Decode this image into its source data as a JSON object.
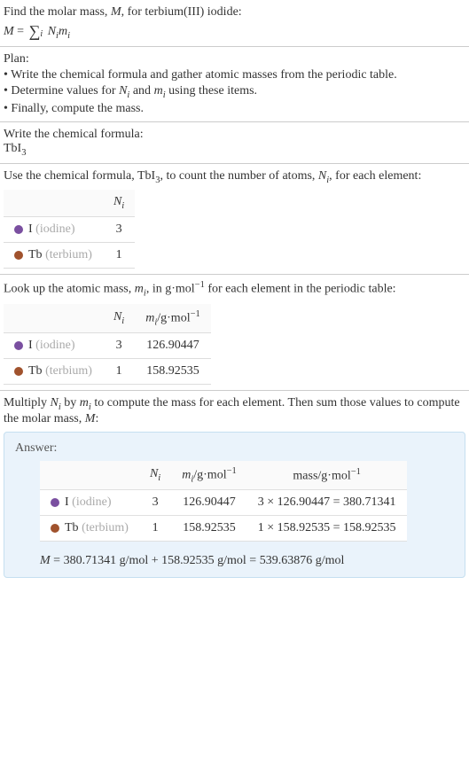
{
  "intro": {
    "line1_prefix": "Find the molar mass, ",
    "line1_var": "M",
    "line1_suffix": ", for terbium(III) iodide:",
    "formula_lhs": "M",
    "formula_eq": " = ",
    "formula_sum_index": "i",
    "formula_N": "N",
    "formula_N_sub": "i",
    "formula_m": "m",
    "formula_m_sub": "i"
  },
  "plan": {
    "title": "Plan:",
    "items": [
      "• Write the chemical formula and gather atomic masses from the periodic table.",
      "• Determine values for ",
      "• Finally, compute the mass."
    ],
    "item2_N": "N",
    "item2_N_sub": "i",
    "item2_mid": " and ",
    "item2_m": "m",
    "item2_m_sub": "i",
    "item2_suffix": " using these items."
  },
  "chem_formula_section": {
    "title": "Write the chemical formula:",
    "formula_base": "TbI",
    "formula_sub": "3"
  },
  "count_section": {
    "prefix": "Use the chemical formula, TbI",
    "formula_sub": "3",
    "mid": ", to count the number of atoms, ",
    "var_N": "N",
    "var_N_sub": "i",
    "suffix": ", for each element:"
  },
  "table1": {
    "header_N": "N",
    "header_N_sub": "i",
    "rows": [
      {
        "color": "#7a4fa0",
        "symbol": "I",
        "name": "(iodine)",
        "n": "3"
      },
      {
        "color": "#a0522d",
        "symbol": "Tb",
        "name": "(terbium)",
        "n": "1"
      }
    ]
  },
  "lookup_section": {
    "prefix": "Look up the atomic mass, ",
    "var_m": "m",
    "var_m_sub": "i",
    "mid": ", in g·mol",
    "exp": "−1",
    "suffix": " for each element in the periodic table:"
  },
  "table2": {
    "header_N": "N",
    "header_N_sub": "i",
    "header_m": "m",
    "header_m_sub": "i",
    "header_m_unit_prefix": "/g·mol",
    "header_m_unit_exp": "−1",
    "rows": [
      {
        "color": "#7a4fa0",
        "symbol": "I",
        "name": "(iodine)",
        "n": "3",
        "m": "126.90447"
      },
      {
        "color": "#a0522d",
        "symbol": "Tb",
        "name": "(terbium)",
        "n": "1",
        "m": "158.92535"
      }
    ]
  },
  "multiply_section": {
    "prefix": "Multiply ",
    "var_N": "N",
    "var_N_sub": "i",
    "mid1": " by ",
    "var_m": "m",
    "var_m_sub": "i",
    "mid2": " to compute the mass for each element. Then sum those values to compute the molar mass, ",
    "var_M": "M",
    "suffix": ":"
  },
  "answer": {
    "label": "Answer:",
    "table": {
      "header_N": "N",
      "header_N_sub": "i",
      "header_m": "m",
      "header_m_sub": "i",
      "header_m_unit_prefix": "/g·mol",
      "header_m_unit_exp": "−1",
      "header_mass_prefix": "mass/g·mol",
      "header_mass_exp": "−1",
      "rows": [
        {
          "color": "#7a4fa0",
          "symbol": "I",
          "name": "(iodine)",
          "n": "3",
          "m": "126.90447",
          "mass": "3 × 126.90447 = 380.71341"
        },
        {
          "color": "#a0522d",
          "symbol": "Tb",
          "name": "(terbium)",
          "n": "1",
          "m": "158.92535",
          "mass": "1 × 158.92535 = 158.92535"
        }
      ]
    },
    "final_M": "M",
    "final_text": " = 380.71341 g/mol + 158.92535 g/mol = 539.63876 g/mol"
  }
}
